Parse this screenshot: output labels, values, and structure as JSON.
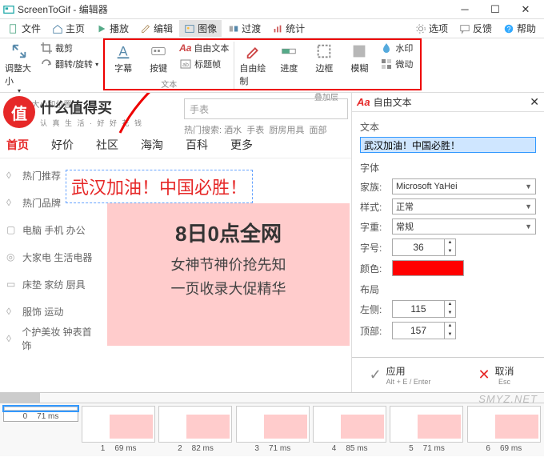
{
  "app": {
    "title": "ScreenToGif - 编辑器"
  },
  "win": {
    "min": "─",
    "max": "☐",
    "close": "✕"
  },
  "menu": {
    "file": "文件",
    "home": "主页",
    "play": "播放",
    "edit": "编辑",
    "image": "图像",
    "transition": "过渡",
    "stats": "统计",
    "options": "选项",
    "feedback": "反馈",
    "help": "帮助"
  },
  "ribbon": {
    "g1": {
      "label": "大小和位置",
      "resize": "调整大小",
      "crop": "裁剪",
      "flip": "翻转/旋转"
    },
    "g2": {
      "label": "文本",
      "caption": "字幕",
      "key": "按键",
      "freetext": "自由文本",
      "title": "标题帧"
    },
    "g3": {
      "label": "叠加层",
      "draw": "自由绘制",
      "progress": "进度",
      "border": "边框",
      "blur": "模糊",
      "water": "水印",
      "shake": "微动"
    }
  },
  "brand": {
    "logo": "值",
    "main": "什么值得买",
    "sub": "认 真 生 活 · 好 好 花 钱"
  },
  "search": {
    "value": "手表",
    "hotlabel": "热门搜索:",
    "hots": [
      "酒水",
      "手表",
      "厨房用具",
      "面部"
    ]
  },
  "nav": [
    "首页",
    "好价",
    "社区",
    "海淘",
    "百科",
    "更多"
  ],
  "cats": [
    "热门推荐",
    "热门品牌",
    "电脑 手机 办公",
    "大家电  生活电器",
    "床垫 家纺 厨具",
    "服饰 运动",
    "个护美妆 钟表首饰"
  ],
  "freetext": "武汉加油！中国必胜！",
  "banner": {
    "l1": "8日0点全网",
    "l2": "女神节神价抢先知",
    "l3": "一页收录大促精华"
  },
  "panel": {
    "title": "自由文本",
    "text_label": "文本",
    "text_value": "武汉加油！中国必胜！",
    "font_section": "字体",
    "family_l": "家族:",
    "family_v": "Microsoft YaHei",
    "style_l": "样式:",
    "style_v": "正常",
    "weight_l": "字重:",
    "weight_v": "常规",
    "size_l": "字号:",
    "size_v": "36",
    "color_l": "颜色:",
    "layout_section": "布局",
    "left_l": "左侧:",
    "left_v": "115",
    "top_l": "顶部:",
    "top_v": "157",
    "apply": "应用",
    "apply_sub": "Alt + E / Enter",
    "cancel": "取消",
    "cancel_sub": "Esc"
  },
  "frames": [
    {
      "idx": "0",
      "ms": "71 ms"
    },
    {
      "idx": "1",
      "ms": "69 ms"
    },
    {
      "idx": "2",
      "ms": "82 ms"
    },
    {
      "idx": "3",
      "ms": "71 ms"
    },
    {
      "idx": "4",
      "ms": "85 ms"
    },
    {
      "idx": "5",
      "ms": "71 ms"
    },
    {
      "idx": "6",
      "ms": "69 ms"
    }
  ],
  "watermark": "SMYZ.NET"
}
